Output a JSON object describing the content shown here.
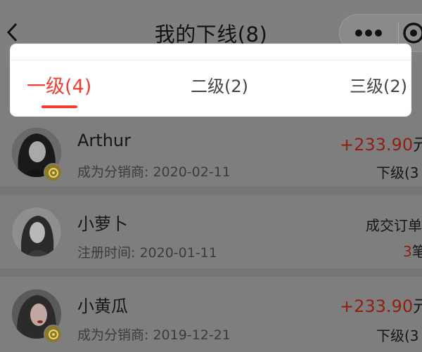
{
  "header": {
    "title": "我的下线(8)"
  },
  "tabs": [
    {
      "label": "一级(4)",
      "active": true
    },
    {
      "label": "二级(2)",
      "active": false
    },
    {
      "label": "三级(2)",
      "active": false
    }
  ],
  "members": [
    {
      "name": "Arthur",
      "sub": "成为分销商: 2020-02-11",
      "amount": "+233.90",
      "amount_unit": "元",
      "right_sub": "下级(3"
    },
    {
      "name": "小萝卜",
      "sub": "注册时间: 2020-01-11",
      "right_top": "成交订单",
      "count_num": "3",
      "count_unit": "笔"
    },
    {
      "name": "小黄瓜",
      "sub": "成为分销商: 2019-12-21",
      "amount": "+233.90",
      "amount_unit": "元",
      "right_sub": "下级(3"
    }
  ],
  "colors": {
    "accent": "#f03d32",
    "amount": "#8f1f14",
    "overlay_bg": "#7e7e7e"
  }
}
